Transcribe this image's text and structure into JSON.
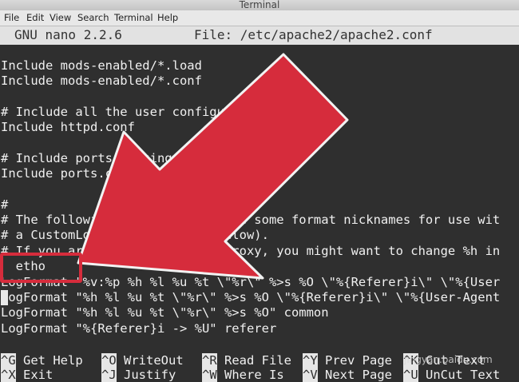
{
  "window": {
    "title": "Terminal"
  },
  "menu": [
    "File",
    "Edit",
    "View",
    "Search",
    "Terminal",
    "Help"
  ],
  "nano": {
    "version": "GNU nano 2.2.6",
    "file": "File: /etc/apache2/apache2.conf"
  },
  "lines": [
    "Include mods-enabled/*.load",
    "Include mods-enabled/*.conf",
    "",
    "# Include all the user configurations:",
    "Include httpd.conf",
    "",
    "# Include ports listing",
    "Include ports.conf",
    "",
    "#",
    "# The following directives define some format nicknames for use wit",
    "# a CustomLog directive (see below).",
    "# If you are behind a reverse proxy, you might want to change %h in",
    "  etho",
    "LogFormat \"%v:%p %h %l %u %t \\\"%r\\\" %>s %O \\\"%{Referer}i\\\" \\\"%{User",
    "LogFormat \"%h %l %u %t \\\"%r\\\" %>s %O \\\"%{Referer}i\\\" \\\"%{User-Agent",
    "LogFormat \"%h %l %u %t \\\"%r\\\" %>s %O\" common",
    "LogFormat \"%{Referer}i -> %U\" referer"
  ],
  "shortcuts": {
    "row1": [
      {
        "key": "^G",
        "label": " Get Help"
      },
      {
        "key": "^O",
        "label": " WriteOut"
      },
      {
        "key": "^R",
        "label": " Read File"
      },
      {
        "key": "^Y",
        "label": " Prev Page"
      },
      {
        "key": "^K",
        "label": " Cut Text"
      }
    ],
    "row2": [
      {
        "key": "^X",
        "label": " Exit"
      },
      {
        "key": "^J",
        "label": " Justify"
      },
      {
        "key": "^W",
        "label": " Where Is"
      },
      {
        "key": "^V",
        "label": " Next Page"
      },
      {
        "key": "^U",
        "label": " UnCut Text"
      }
    ]
  },
  "watermark": "jingyan.baidu.com",
  "colors": {
    "arrow": "#d62c3c",
    "terminal_bg": "#2f2f2f"
  }
}
